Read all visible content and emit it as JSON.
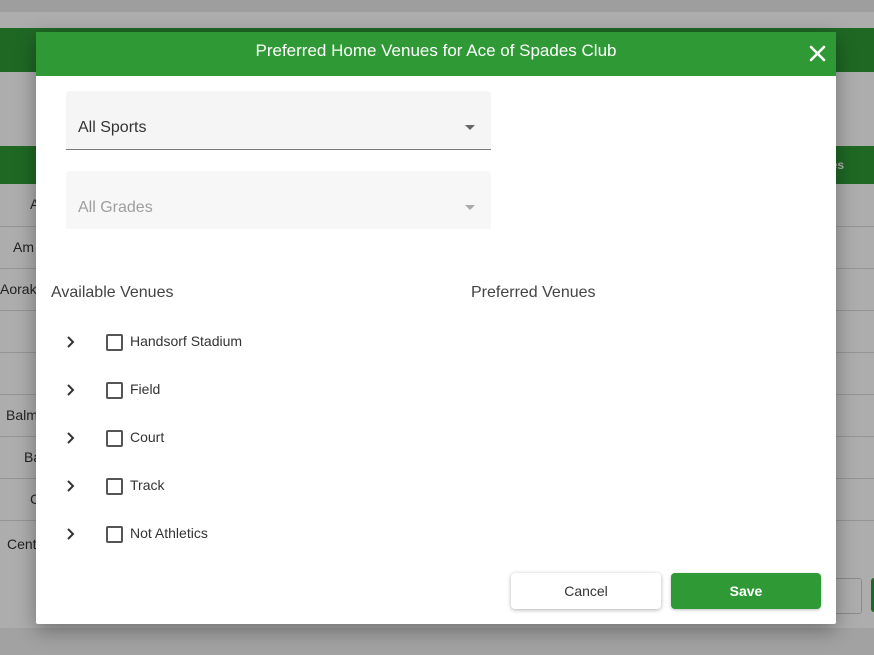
{
  "background": {
    "header_fragment": "es",
    "row_fragments": [
      "A",
      "Am",
      "Aoraki",
      "",
      "",
      "Balm",
      "Ba",
      "C",
      "Cent"
    ]
  },
  "dialog": {
    "title": "Preferred Home Venues for Ace of Spades Club",
    "close_icon": "close-icon",
    "sport_select": {
      "value": "All Sports"
    },
    "grade_select": {
      "value": "All Grades",
      "disabled": true
    },
    "available_label": "Available Venues",
    "preferred_label": "Preferred Venues",
    "venues": [
      {
        "label": "Handsorf Stadium"
      },
      {
        "label": "Field"
      },
      {
        "label": "Court"
      },
      {
        "label": "Track"
      },
      {
        "label": "Not Athletics"
      }
    ],
    "preferred_venues": [],
    "cancel_label": "Cancel",
    "save_label": "Save"
  },
  "colors": {
    "accent": "#2f9a35",
    "header_text": "#ffffff"
  }
}
